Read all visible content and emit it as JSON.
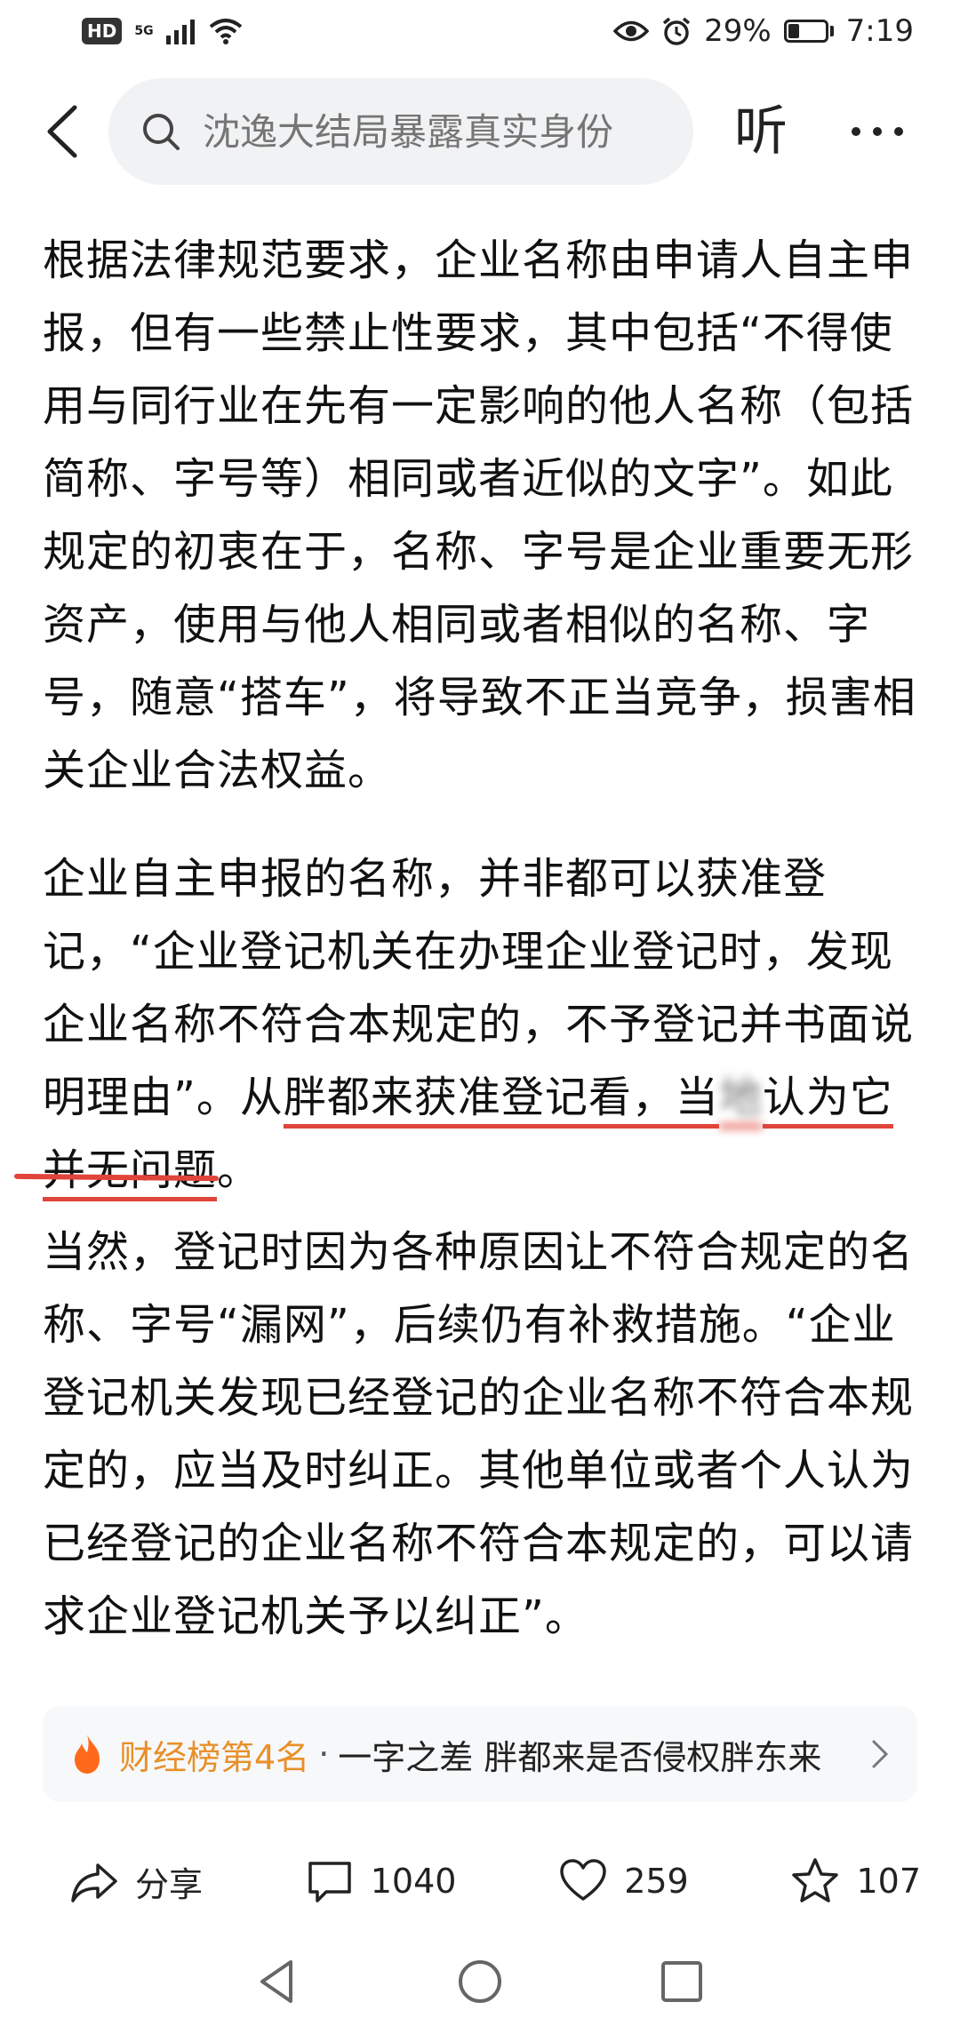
{
  "status_bar": {
    "hd": "HD",
    "network": "5G",
    "battery": "29%",
    "battery_level": 0.29,
    "time": "7:19"
  },
  "header": {
    "search_placeholder": "沈逸大结局暴露真实身份",
    "listen_label": "听"
  },
  "article": {
    "paragraphs": [
      {
        "text": "根据法律规范要求，企业名称由申请人自主申报，但有一些禁止性要求，其中包括“不得使用与同行业在先有一定影响的他人名称（包括简称、字号等）相同或者近似的文字”。如此规定的初衷在于，名称、字号是企业重要无形资产，使用与他人相同或者相似的名称、字号，随意“搭车”，将导致不正当竞争，损害相关企业合法权益。"
      },
      {
        "before": "企业自主申报的名称，并非都可以获准登记，“企业登记机关在办理企业登记时，发现企业名称不符合本规定的，不予登记并书面说明理由”。从",
        "underlined_a": "胖都来获准登记看，当",
        "blurred": "地",
        "underlined_b": "认为它并无问题",
        "after": "。"
      },
      {
        "text": "当然，登记时因为各种原因让不符合规定的名称、字号“漏网”，后续仍有补救措施。“企业登记机关发现已经登记的企业名称不符合本规定的，应当及时纠正。其他单位或者个人认为已经登记的企业名称不符合本规定的，可以请求企业登记机关予以纠正”。"
      }
    ]
  },
  "rank_card": {
    "label": "财经榜第4名",
    "separator": "·",
    "title": "一字之差 胖都来是否侵权胖东来"
  },
  "actions": {
    "share_label": "分享",
    "comment_count": "1040",
    "like_count": "259",
    "favorite_count": "107"
  },
  "colors": {
    "underline": "#e0443a",
    "rank_label": "#e8902a",
    "fire": "#ff6a1a"
  }
}
